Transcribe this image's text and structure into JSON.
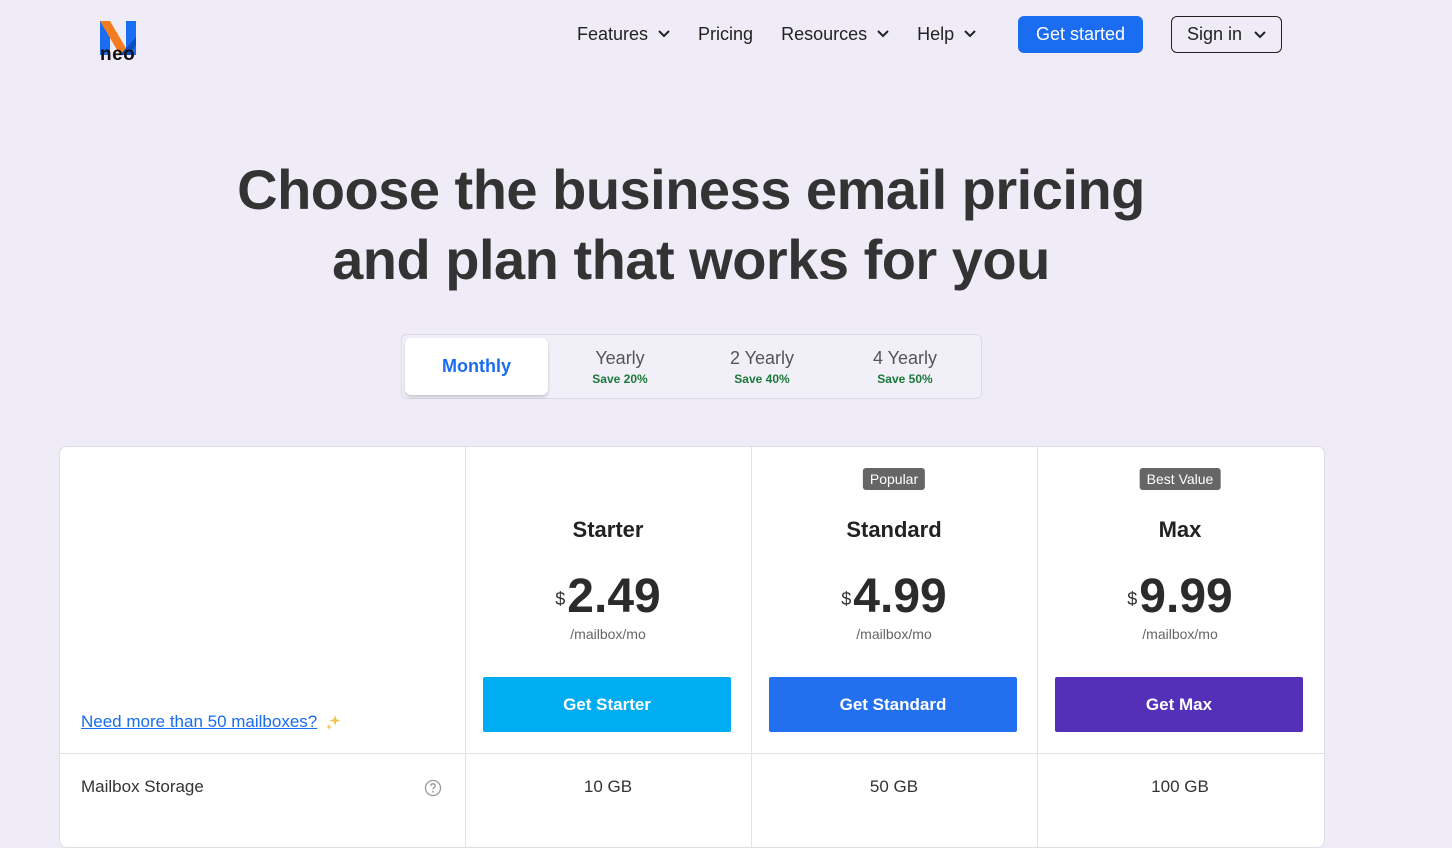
{
  "header": {
    "logo_text": "neo",
    "nav": [
      {
        "label": "Features",
        "has_dropdown": true
      },
      {
        "label": "Pricing",
        "has_dropdown": false
      },
      {
        "label": "Resources",
        "has_dropdown": true
      },
      {
        "label": "Help",
        "has_dropdown": true
      }
    ],
    "get_started_label": "Get started",
    "sign_in_label": "Sign in"
  },
  "hero": {
    "line1": "Choose the business email pricing",
    "line2": "and plan that works for you"
  },
  "billing_tabs": [
    {
      "label": "Monthly",
      "save": "",
      "active": true
    },
    {
      "label": "Yearly",
      "save": "Save 20%",
      "active": false
    },
    {
      "label": "2 Yearly",
      "save": "Save 40%",
      "active": false
    },
    {
      "label": "4 Yearly",
      "save": "Save 50%",
      "active": false
    }
  ],
  "pricing": {
    "need_more_link": "Need more than 50 mailboxes?",
    "plans": [
      {
        "badge": "",
        "name": "Starter",
        "currency": "$",
        "price": "2.49",
        "period": "/mailbox/mo",
        "button": "Get Starter",
        "color": "#00adf2"
      },
      {
        "badge": "Popular",
        "name": "Standard",
        "currency": "$",
        "price": "4.99",
        "period": "/mailbox/mo",
        "button": "Get Standard",
        "color": "#226ff0"
      },
      {
        "badge": "Best Value",
        "name": "Max",
        "currency": "$",
        "price": "9.99",
        "period": "/mailbox/mo",
        "button": "Get Max",
        "color": "#5430b9"
      }
    ],
    "features": [
      {
        "label": "Mailbox Storage",
        "values": [
          "10 GB",
          "50 GB",
          "100 GB"
        ]
      }
    ]
  },
  "colors": {
    "background": "#efecf8",
    "accent": "#1a6cf0",
    "save_green": "#1a7a3a",
    "logo_blue": "#1a6cf0",
    "logo_orange": "#f47b20"
  }
}
